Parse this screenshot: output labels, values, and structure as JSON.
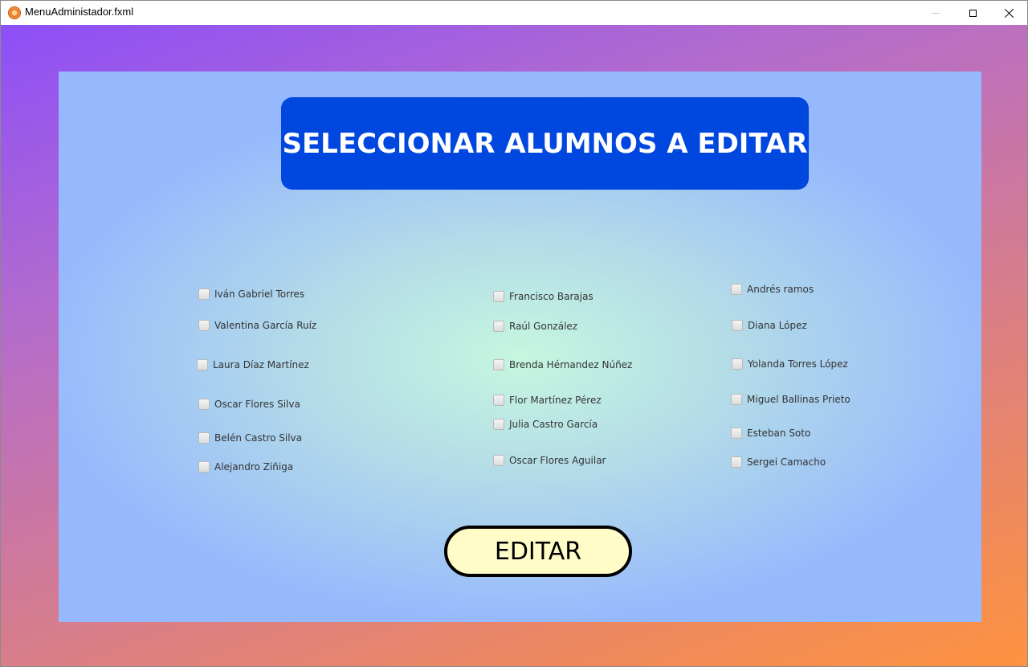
{
  "window": {
    "title": "MenuAdministador.fxml",
    "controls": {
      "minimize": "minimize",
      "maximize": "maximize",
      "close": "close"
    }
  },
  "panel": {
    "header": "SELECCIONAR ALUMNOS A EDITAR",
    "columns": [
      [
        {
          "label": "Iván Gabriel Torres",
          "checked": false
        },
        {
          "label": "Valentina García Ruíz",
          "checked": false
        },
        {
          "label": "Laura Díaz Martínez",
          "checked": false
        },
        {
          "label": "Oscar Flores Silva",
          "checked": false
        },
        {
          "label": "Belén Castro Silva",
          "checked": false
        },
        {
          "label": "Alejandro Ziñiga",
          "checked": false
        }
      ],
      [
        {
          "label": "Francisco Barajas",
          "checked": false
        },
        {
          "label": "Raúl González",
          "checked": false
        },
        {
          "label": "Brenda Hérnandez Núñez",
          "checked": false
        },
        {
          "label": "Flor Martínez Pérez",
          "checked": false
        },
        {
          "label": "Julia Castro García",
          "checked": false
        },
        {
          "label": "Oscar Flores Aguilar",
          "checked": false
        }
      ],
      [
        {
          "label": "Andrés ramos",
          "checked": false
        },
        {
          "label": "Diana López",
          "checked": false
        },
        {
          "label": "Yolanda Torres López",
          "checked": false
        },
        {
          "label": "Miguel Ballinas Prieto",
          "checked": false
        },
        {
          "label": "Esteban Soto",
          "checked": false
        },
        {
          "label": "Sergei Camacho",
          "checked": false
        }
      ]
    ],
    "edit_button": "EDITAR"
  },
  "colors": {
    "header_bg": "#0047df",
    "header_text": "#ffffff",
    "button_bg": "#fffcc8",
    "button_border": "#000000",
    "panel_center": "#c6f7df",
    "panel_edge": "#96b9fd",
    "bg_gradient_start": "#8c4ff8",
    "bg_gradient_end": "#ff9340"
  }
}
